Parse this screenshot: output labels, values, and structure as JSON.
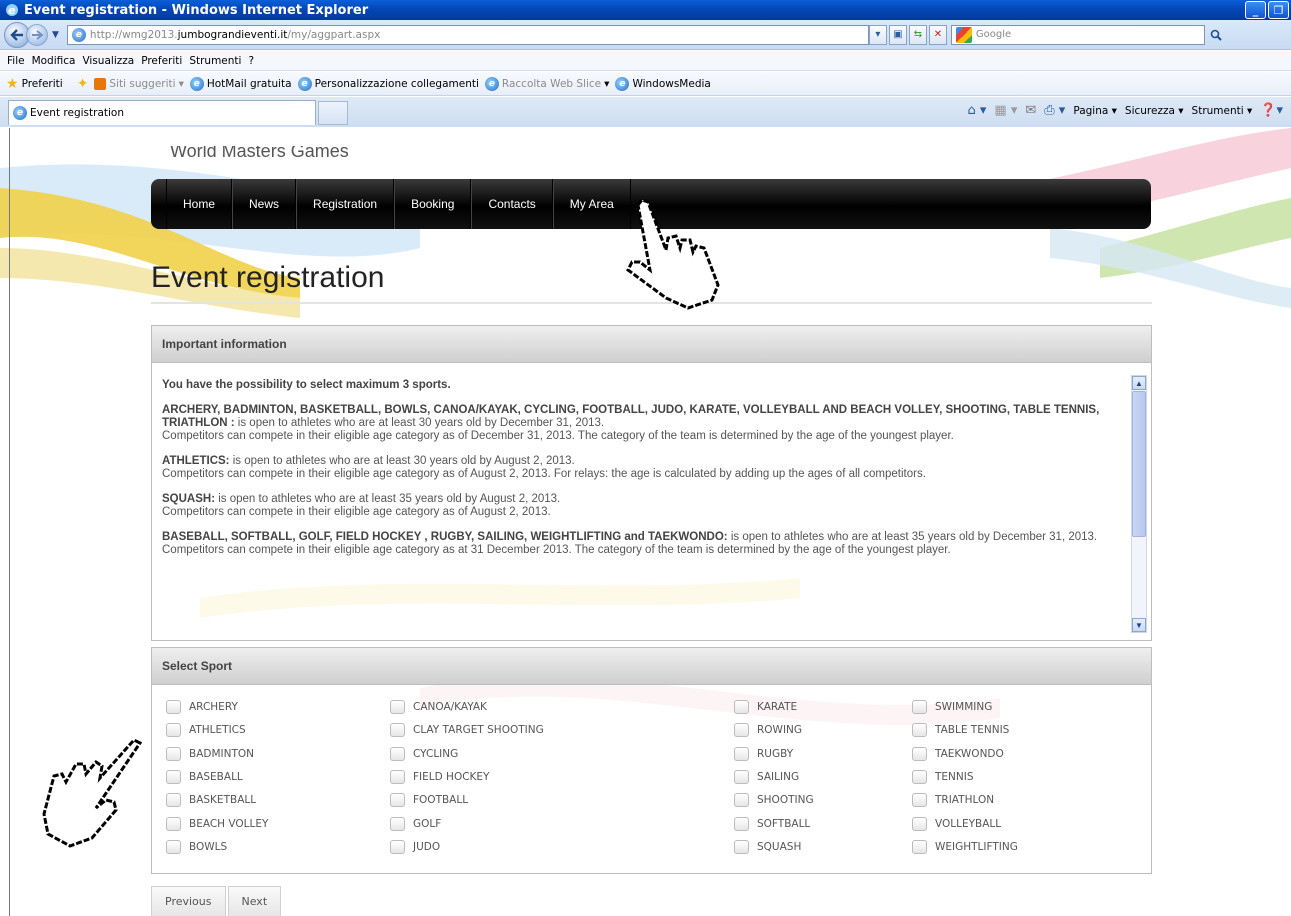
{
  "window": {
    "title": "Event registration - Windows Internet Explorer"
  },
  "addressbar": {
    "url_prefix": "http://wmg2013.",
    "url_domain": "jumbograndieventi.it",
    "url_path": "/my/aggpart.aspx",
    "search_placeholder": "Google"
  },
  "menubar": [
    "File",
    "Modifica",
    "Visualizza",
    "Preferiti",
    "Strumenti",
    "?"
  ],
  "favorites": {
    "label": "Preferiti",
    "items": [
      {
        "label": "Siti suggeriti",
        "muted": true
      },
      {
        "label": "HotMail gratuita",
        "muted": false
      },
      {
        "label": "Personalizzazione collegamenti",
        "muted": false
      },
      {
        "label": "Raccolta Web Slice",
        "muted": true
      },
      {
        "label": "WindowsMedia",
        "muted": false
      }
    ]
  },
  "tabs": {
    "active": "Event registration"
  },
  "commandbar": [
    "Pagina",
    "Sicurezza",
    "Strumenti"
  ],
  "site": {
    "name": "World Masters Games",
    "nav": [
      "Home",
      "News",
      "Registration",
      "Booking",
      "Contacts",
      "My Area"
    ],
    "page_title": "Event registration"
  },
  "important": {
    "header": "Important information",
    "intro": "You have the possibility to select maximum 3 sports.",
    "p1_bold": "ARCHERY, BADMINTON, BASKETBALL, BOWLS, CANOA/KAYAK, CYCLING, FOOTBALL, JUDO, KARATE, VOLLEYBALL AND BEACH VOLLEY, SHOOTING, TABLE TENNIS, TRIATHLON :",
    "p1_text": " is open to athletes who are at least 30 years old by December 31, 2013.",
    "p1_line2": "Competitors can compete in their eligible age category as of December 31, 2013. The category of the team is determined by the age of the youngest player.",
    "p2_bold": "ATHLETICS:",
    "p2_text": " is open to athletes who are at least 30 years old by August 2, 2013.",
    "p2_line2": "Competitors can compete in their eligible age category as of August 2, 2013. For relays: the age is calculated by adding up the ages of all competitors.",
    "p3_bold": "SQUASH:",
    "p3_text": " is open to athletes who are at least 35 years old by August 2, 2013.",
    "p3_line2": "Competitors can compete in their eligible age category as of August 2, 2013.",
    "p4_bold": "BASEBALL, SOFTBALL, GOLF, FIELD HOCKEY , RUGBY, SAILING, WEIGHTLIFTING and TAEKWONDO:",
    "p4_text": " is open to athletes who are at least 35 years old by December 31, 2013.",
    "p4_line2": "Competitors can compete in their eligible age category as at 31 December 2013. The category of the team is determined by the age of the youngest player."
  },
  "select_sport": {
    "header": "Select Sport",
    "columns": [
      [
        "ARCHERY",
        "ATHLETICS",
        "BADMINTON",
        "BASEBALL",
        "BASKETBALL",
        "BEACH VOLLEY",
        "BOWLS"
      ],
      [
        "CANOA/KAYAK",
        "CLAY TARGET SHOOTING",
        "CYCLING",
        "FIELD HOCKEY",
        "FOOTBALL",
        "GOLF",
        "JUDO"
      ],
      [
        "KARATE",
        "ROWING",
        "RUGBY",
        "SAILING",
        "SHOOTING",
        "SOFTBALL",
        "SQUASH"
      ],
      [
        "SWIMMING",
        "TABLE TENNIS",
        "TAEKWONDO",
        "TENNIS",
        "TRIATHLON",
        "VOLLEYBALL",
        "WEIGHTLIFTING"
      ]
    ]
  },
  "pager": {
    "previous": "Previous",
    "next": "Next"
  },
  "colors": {
    "titlebar": "#0447b6",
    "nav_bg": "#000000",
    "panel_header": "#cfcfcf"
  }
}
